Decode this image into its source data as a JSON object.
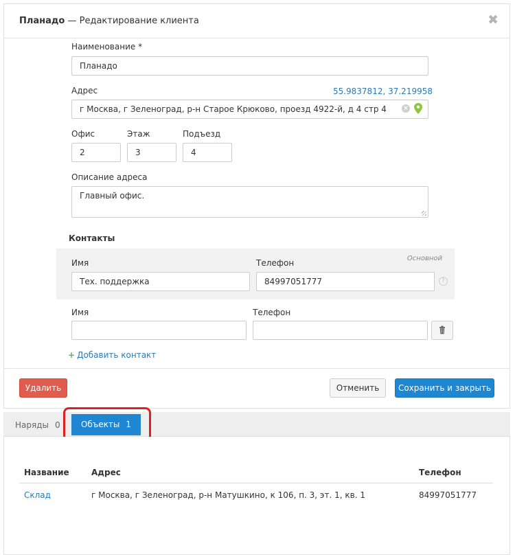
{
  "modal": {
    "title_bold": "Планадо",
    "title_rest": " — Редактирование клиента",
    "close_symbol": "✖"
  },
  "form": {
    "name_label": "Наименование *",
    "name_value": "Планадо",
    "address_label": "Адрес",
    "coordinates": "55.9837812, 37.219958",
    "address_value": "г Москва, г Зеленоград, р-н Старое Крюково, проезд 4922-й, д 4 стр 4",
    "office_label": "Офис",
    "office_value": "2",
    "floor_label": "Этаж",
    "floor_value": "3",
    "entrance_label": "Подъезд",
    "entrance_value": "4",
    "address_desc_label": "Описание адреса",
    "address_desc_value": "Главный офис."
  },
  "contacts": {
    "title": "Контакты",
    "main_badge": "Основной",
    "items": [
      {
        "name_label": "Имя",
        "name_value": "Тех. поддержка",
        "phone_label": "Телефон",
        "phone_value": "84997051777"
      },
      {
        "name_label": "Имя",
        "name_value": "",
        "phone_label": "Телефон",
        "phone_value": ""
      }
    ],
    "add_label": "Добавить контакт",
    "help_symbol": "?"
  },
  "buttons": {
    "delete": "Удалить",
    "cancel": "Отменить",
    "save_close": "Сохранить и закрыть"
  },
  "tabs": [
    {
      "label": "Наряды",
      "count": "0",
      "active": false
    },
    {
      "label": "Объекты",
      "count": "1",
      "active": true
    }
  ],
  "objects_table": {
    "headers": [
      "Название",
      "Адрес",
      "Телефон"
    ],
    "rows": [
      {
        "name": "Склад",
        "address": "г Москва, г Зеленоград, р-н Матушкино, к 106, п. 3, эт. 1, кв. 1",
        "phone": "84997051777"
      }
    ]
  },
  "colors": {
    "primary": "#1f87d1",
    "danger": "#e05c4c",
    "link": "#2a7ab5",
    "pin": "#8dc63f",
    "highlight": "#e02020"
  },
  "icons": {
    "close": "close-icon",
    "clear": "clear-icon",
    "pin": "map-pin-icon",
    "plus": "plus-icon",
    "trash": "trash-icon",
    "help": "help-icon",
    "resize": "resize-grip-icon"
  }
}
